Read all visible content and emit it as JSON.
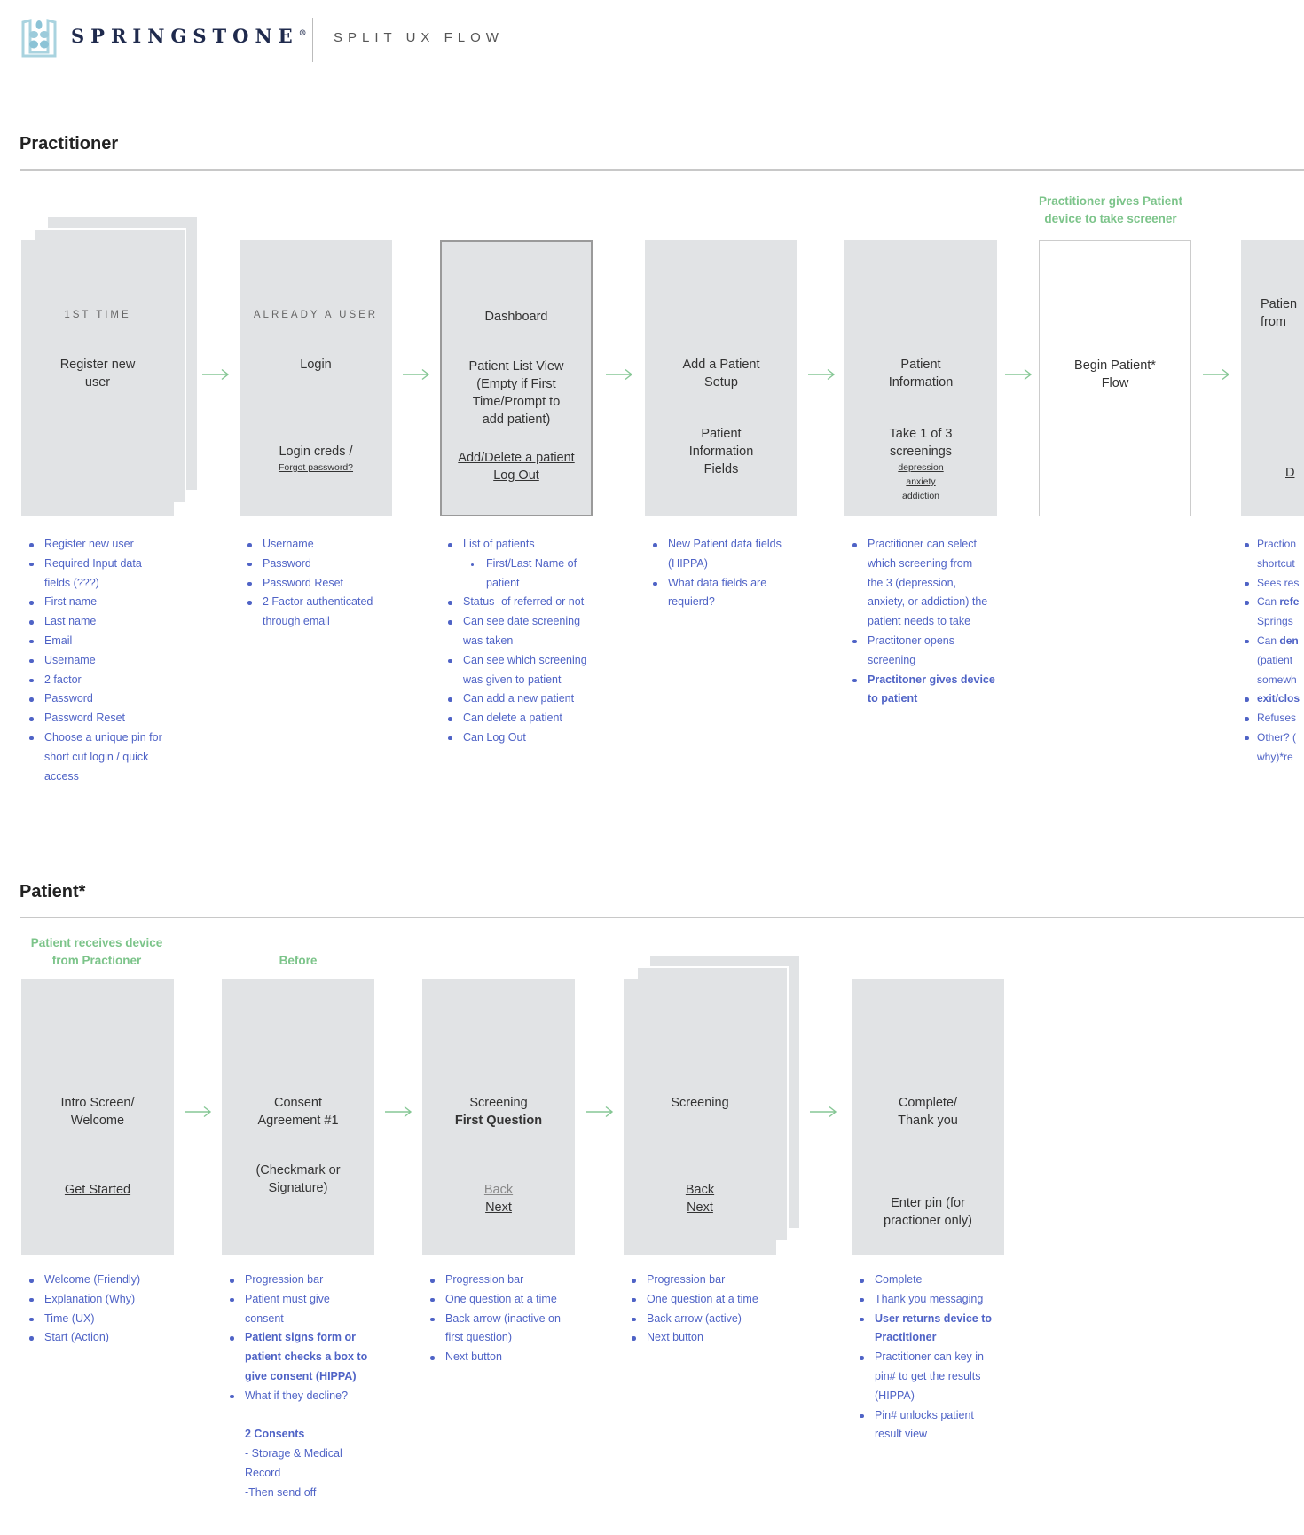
{
  "header": {
    "brand": "SPRINGSTONE",
    "brand_mark": "®",
    "subtitle": "SPLIT UX FLOW",
    "logo_icon": "springstone-logo"
  },
  "colors": {
    "card": "#e1e3e5",
    "note": "#7cc48a",
    "bullet_text": "#4f63c6",
    "brand": "#1f2a4d"
  },
  "practitioner": {
    "title": "Practitioner",
    "note": [
      "Practitioner gives Patient",
      "device to take screener"
    ],
    "cards": [
      {
        "name": "register",
        "blocks": [
          {
            "kind": "label",
            "text": [
              "1ST TIME"
            ]
          },
          {
            "kind": "title",
            "text": [
              "Register new",
              "user"
            ]
          }
        ]
      },
      {
        "name": "login",
        "blocks": [
          {
            "kind": "label",
            "text": [
              "ALREADY A USER"
            ]
          },
          {
            "kind": "title",
            "text": [
              "Login"
            ]
          },
          {
            "kind": "title",
            "text": [
              "Login creds /"
            ]
          },
          {
            "kind": "small",
            "text": [
              "Forgot password?"
            ]
          }
        ]
      },
      {
        "name": "dashboard",
        "blocks": [
          {
            "kind": "title",
            "text": [
              "Dashboard"
            ]
          },
          {
            "kind": "title",
            "text": [
              "Patient List View",
              "(Empty if First",
              "Time/Prompt to",
              "add patient)"
            ]
          },
          {
            "kind": "link",
            "text": [
              "Add/Delete a patient",
              "Log Out"
            ]
          }
        ]
      },
      {
        "name": "add-patient",
        "blocks": [
          {
            "kind": "title",
            "text": [
              "Add a Patient",
              "Setup"
            ]
          },
          {
            "kind": "title",
            "text": [
              "Patient",
              "Information",
              "Fields"
            ]
          }
        ]
      },
      {
        "name": "patient-information",
        "blocks": [
          {
            "kind": "title",
            "text": [
              "Patient",
              "Information"
            ]
          },
          {
            "kind": "title",
            "text": [
              "Take 1 of 3",
              "screenings"
            ]
          },
          {
            "kind": "small",
            "text": [
              "depression",
              "anxiety",
              "addiction"
            ]
          }
        ]
      },
      {
        "name": "begin-patient-flow",
        "blocks": [
          {
            "kind": "title",
            "text": [
              "Begin Patient*",
              "Flow"
            ]
          }
        ]
      },
      {
        "name": "patient-returned",
        "blocks": [
          {
            "kind": "title",
            "text": [
              "Patien",
              "from"
            ]
          },
          {
            "kind": "link",
            "text": [
              "D"
            ]
          }
        ]
      }
    ],
    "lists": [
      [
        {
          "lines": [
            "Register new user"
          ]
        },
        {
          "lines": [
            "Required Input data",
            "fields (???)"
          ]
        },
        {
          "lines": [
            "First name"
          ]
        },
        {
          "lines": [
            "Last name"
          ]
        },
        {
          "lines": [
            "Email"
          ]
        },
        {
          "lines": [
            "Username"
          ]
        },
        {
          "lines": [
            "2 factor"
          ]
        },
        {
          "lines": [
            "Password"
          ]
        },
        {
          "lines": [
            "Password Reset"
          ]
        },
        {
          "lines": [
            "Choose a unique pin for",
            "short cut login / quick",
            "access"
          ]
        }
      ],
      [
        {
          "lines": [
            "Username"
          ]
        },
        {
          "lines": [
            "Password"
          ]
        },
        {
          "lines": [
            "Password Reset"
          ]
        },
        {
          "lines": [
            "2 Factor authenticated",
            "through email"
          ]
        }
      ],
      [
        {
          "lines": [
            "List of patients"
          ]
        },
        {
          "sub": true,
          "lines": [
            "First/Last Name of",
            "patient"
          ]
        },
        {
          "lines": [
            "Status -of referred or not"
          ]
        },
        {
          "lines": [
            "Can see date screening",
            "was taken"
          ]
        },
        {
          "lines": [
            "Can see which screening",
            "was given to patient"
          ]
        },
        {
          "lines": [
            "Can add a new patient"
          ]
        },
        {
          "lines": [
            "Can delete a patient"
          ]
        },
        {
          "lines": [
            "Can Log Out"
          ]
        }
      ],
      [
        {
          "lines": [
            "New Patient data fields",
            "(HIPPA)"
          ]
        },
        {
          "lines": [
            "What data fields are",
            "requierd?"
          ]
        }
      ],
      [
        {
          "lines": [
            "Practitioner can select",
            "which screening from",
            "the 3 (depression,",
            "anxiety, or addiction) the",
            "patient needs to take"
          ]
        },
        {
          "lines": [
            "Practitoner opens",
            "screening"
          ]
        },
        {
          "bold": true,
          "lines": [
            "Practitoner gives device",
            "to patient"
          ]
        }
      ],
      [],
      [
        {
          "lines": [
            "Praction",
            "shortcut"
          ]
        },
        {
          "lines": [
            "Sees res"
          ]
        },
        {
          "lines": [
            [
              "Can ",
              "refe"
            ],
            "Springs"
          ]
        },
        {
          "lines": [
            [
              "Can ",
              "den"
            ],
            "(patient",
            "somewh"
          ]
        },
        {
          "bold": true,
          "lines": [
            "exit/clos"
          ]
        },
        {
          "lines": [
            "Refuses"
          ]
        },
        {
          "lines": [
            "Other? (",
            "why)*re"
          ]
        }
      ]
    ]
  },
  "patient": {
    "title": "Patient*",
    "notes": [
      [
        "Patient receives device",
        "from Practioner"
      ],
      [
        "Before"
      ]
    ],
    "cards": [
      {
        "name": "intro-welcome",
        "blocks": [
          {
            "kind": "title",
            "text": [
              "Intro Screen/",
              "Welcome"
            ]
          },
          {
            "kind": "link",
            "text": [
              "Get Started"
            ]
          }
        ]
      },
      {
        "name": "consent-agreement",
        "blocks": [
          {
            "kind": "title",
            "text": [
              "Consent",
              "Agreement #1"
            ]
          },
          {
            "kind": "title",
            "text": [
              "(Checkmark or",
              "Signature)"
            ]
          }
        ]
      },
      {
        "name": "screening-first-question",
        "blocks": [
          {
            "kind": "title",
            "text": [
              "Screening"
            ]
          },
          {
            "kind": "bold",
            "text": [
              "First Question"
            ]
          },
          {
            "kind": "muted",
            "text": [
              "Back"
            ]
          },
          {
            "kind": "link",
            "text": [
              "Next"
            ]
          }
        ]
      },
      {
        "name": "screening",
        "blocks": [
          {
            "kind": "title",
            "text": [
              "Screening"
            ]
          },
          {
            "kind": "link",
            "text": [
              "Back",
              "Next"
            ]
          }
        ]
      },
      {
        "name": "complete-thank-you",
        "blocks": [
          {
            "kind": "title",
            "text": [
              "Complete/",
              "Thank you"
            ]
          },
          {
            "kind": "title",
            "text": [
              "Enter pin (for",
              "practioner only)"
            ]
          }
        ]
      }
    ],
    "lists": [
      [
        {
          "lines": [
            "Welcome (Friendly)"
          ]
        },
        {
          "lines": [
            "Explanation (Why)"
          ]
        },
        {
          "lines": [
            "Time (UX)"
          ]
        },
        {
          "lines": [
            "Start (Action)"
          ]
        }
      ],
      [
        {
          "lines": [
            "Progression bar"
          ]
        },
        {
          "lines": [
            "Patient must give",
            "consent"
          ]
        },
        {
          "bold": true,
          "lines": [
            "Patient signs form or",
            "patient checks a box to",
            "give consent (HIPPA)"
          ]
        },
        {
          "lines": [
            "What if they decline?"
          ]
        },
        {
          "plain": true,
          "lines": [
            ""
          ]
        },
        {
          "plain": true,
          "bold": true,
          "lines": [
            "2 Consents"
          ]
        },
        {
          "plain": true,
          "lines": [
            "- Storage & Medical",
            "Record",
            "-Then send off"
          ]
        }
      ],
      [
        {
          "lines": [
            "Progression bar"
          ]
        },
        {
          "lines": [
            "One question at a time"
          ]
        },
        {
          "lines": [
            "Back arrow (inactive on",
            "first question)"
          ]
        },
        {
          "lines": [
            "Next button"
          ]
        }
      ],
      [
        {
          "lines": [
            "Progression bar"
          ]
        },
        {
          "lines": [
            "One question at a time"
          ]
        },
        {
          "lines": [
            "Back arrow (active)"
          ]
        },
        {
          "lines": [
            "Next button"
          ]
        }
      ],
      [
        {
          "lines": [
            "Complete"
          ]
        },
        {
          "lines": [
            "Thank you messaging"
          ]
        },
        {
          "bold": true,
          "lines": [
            "User returns device to",
            "Practitioner"
          ]
        },
        {
          "lines": [
            "Practitioner can key in",
            "pin# to get the results",
            "(HIPPA)"
          ]
        },
        {
          "lines": [
            "Pin# unlocks patient",
            "result view"
          ]
        }
      ]
    ]
  }
}
